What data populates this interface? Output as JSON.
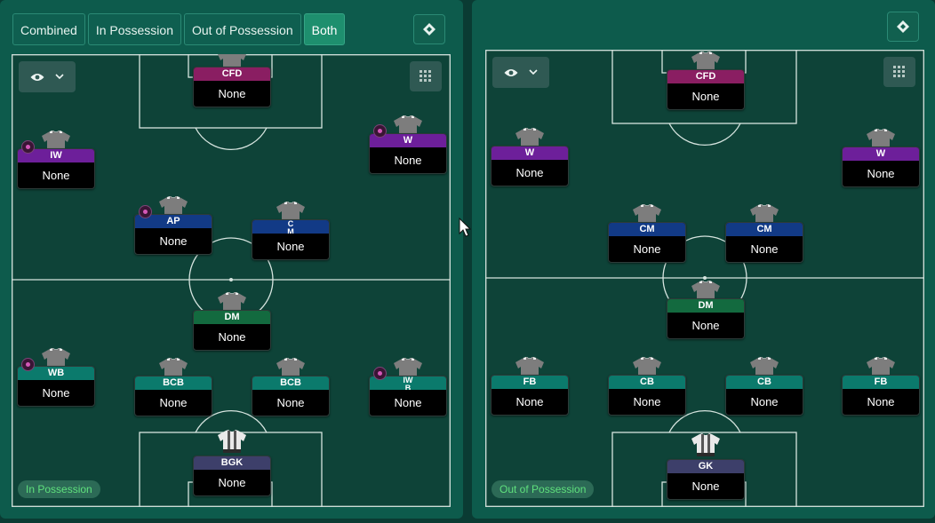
{
  "tabs": [
    {
      "label": "Combined",
      "active": false
    },
    {
      "label": "In Possession",
      "active": false
    },
    {
      "label": "Out of Possession",
      "active": false
    },
    {
      "label": "Both",
      "active": true
    }
  ],
  "icons": {
    "view": "eye-icon",
    "dropdown": "chevron-down-icon",
    "layout": "grid-icon",
    "tactics_menu": "diamond-icon",
    "player_kit": "shirt-icon",
    "goalkeeper_kit": "goalkeeper-shirt-icon",
    "favourite": "familiarity-dot-icon"
  },
  "colors": {
    "panel": "#0d5b4c",
    "pitch": "#0e4338",
    "badge_text": "#5fe07d",
    "active_tab": "#1e8f6e"
  },
  "pitches": {
    "in_possession": {
      "phase_label": "In Possession",
      "players": [
        {
          "role": "CFD",
          "duty": "None"
        },
        {
          "role": "IW",
          "duty": "None"
        },
        {
          "role": "W",
          "duty": "None"
        },
        {
          "role": "AP",
          "duty": "None"
        },
        {
          "role": "C\nM",
          "duty": "None"
        },
        {
          "role": "DM",
          "duty": "None"
        },
        {
          "role": "WB",
          "duty": "None"
        },
        {
          "role": "BCB",
          "duty": "None"
        },
        {
          "role": "BCB",
          "duty": "None"
        },
        {
          "role": "IW\nB",
          "duty": "None"
        },
        {
          "role": "BGK",
          "duty": "None"
        }
      ]
    },
    "out_of_possession": {
      "phase_label": "Out of Possession",
      "players": [
        {
          "role": "CFD",
          "duty": "None"
        },
        {
          "role": "W",
          "duty": "None"
        },
        {
          "role": "W",
          "duty": "None"
        },
        {
          "role": "CM",
          "duty": "None"
        },
        {
          "role": "CM",
          "duty": "None"
        },
        {
          "role": "DM",
          "duty": "None"
        },
        {
          "role": "FB",
          "duty": "None"
        },
        {
          "role": "CB",
          "duty": "None"
        },
        {
          "role": "CB",
          "duty": "None"
        },
        {
          "role": "FB",
          "duty": "None"
        },
        {
          "role": "GK",
          "duty": "None"
        }
      ]
    }
  }
}
